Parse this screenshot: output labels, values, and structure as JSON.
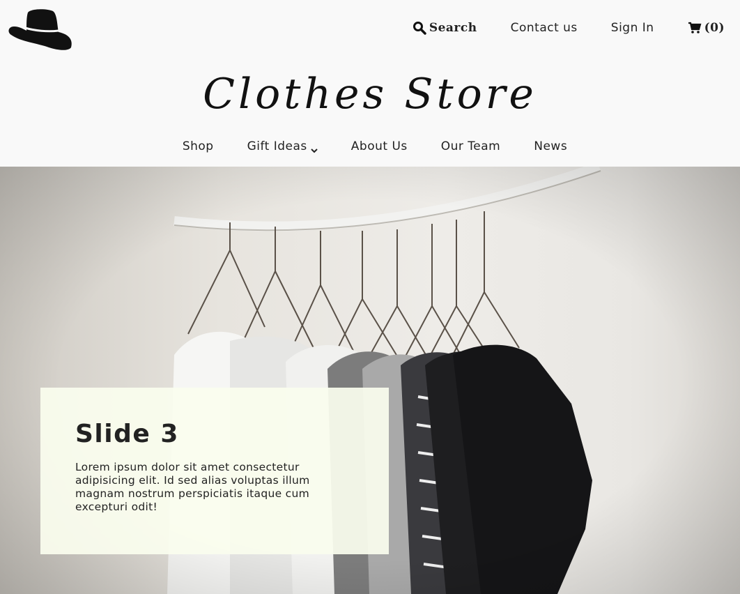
{
  "header": {
    "logo_icon": "hat-icon",
    "links": {
      "search": "Search",
      "contact": "Contact us",
      "signin": "Sign In",
      "cart": "(0)"
    }
  },
  "brand": {
    "title": "Clothes Store"
  },
  "nav": {
    "shop": "Shop",
    "gift_ideas": "Gift Ideas",
    "about": "About Us",
    "team": "Our Team",
    "news": "News"
  },
  "hero": {
    "slide_title": "Slide 3",
    "slide_text": "Lorem ipsum dolor sit amet consectetur adipisicing elit. Id sed alias voluptas illum magnam nostrum perspiciatis itaque cum excepturi odit!"
  },
  "colors": {
    "caption_bg": "#fafdee",
    "text": "#222222"
  }
}
